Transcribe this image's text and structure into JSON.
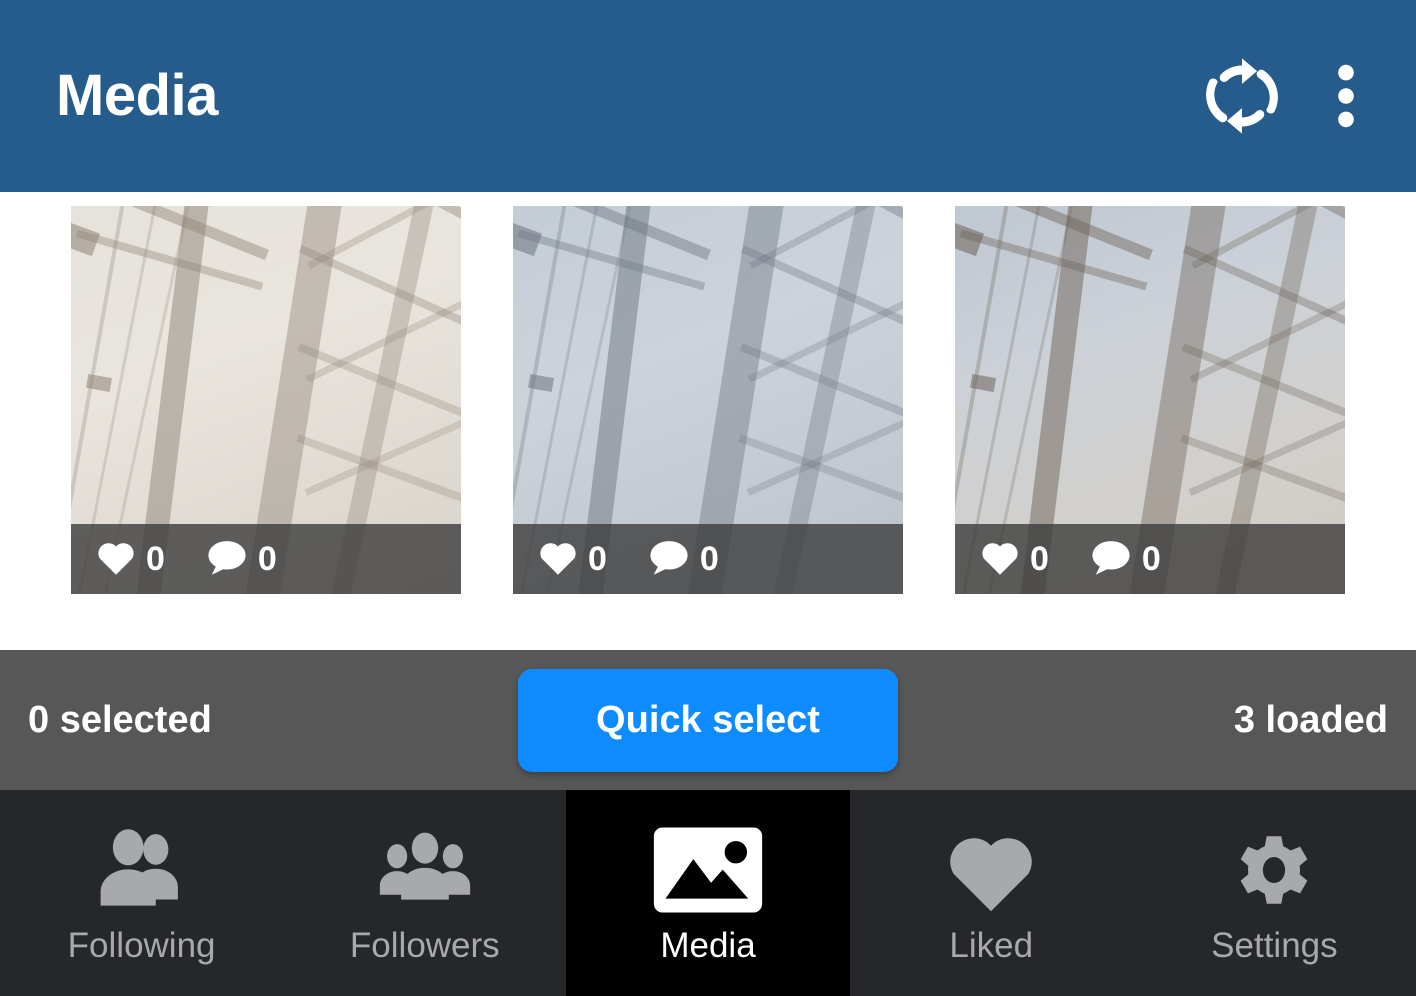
{
  "header": {
    "title": "Media",
    "refresh_icon": "refresh-sync-icon",
    "overflow_icon": "more-vertical-icon"
  },
  "media_grid": {
    "tiles": [
      {
        "like_icon": "heart-icon",
        "likes": "0",
        "comment_icon": "comment-bubble-icon",
        "comments": "0",
        "alt": "electricity pylon lattice tower"
      },
      {
        "like_icon": "heart-icon",
        "likes": "0",
        "comment_icon": "comment-bubble-icon",
        "comments": "0",
        "alt": "electricity pylon lattice tower"
      },
      {
        "like_icon": "heart-icon",
        "likes": "0",
        "comment_icon": "comment-bubble-icon",
        "comments": "0",
        "alt": "electricity pylon lattice tower"
      }
    ]
  },
  "action_bar": {
    "selected_label": "0 selected",
    "quick_select_label": "Quick select",
    "loaded_label": "3 loaded",
    "button_color": "#0d8bff",
    "background_color": "#575757"
  },
  "bottom_nav": {
    "active": "Media",
    "items": [
      {
        "label": "Following",
        "icon": "two-people-icon",
        "active": false
      },
      {
        "label": "Followers",
        "icon": "group-people-icon",
        "active": false
      },
      {
        "label": "Media",
        "icon": "image-picture-icon",
        "active": true
      },
      {
        "label": "Liked",
        "icon": "heart-icon",
        "active": false
      },
      {
        "label": "Settings",
        "icon": "gear-icon",
        "active": false
      }
    ]
  },
  "colors": {
    "appbar": "#255c8b",
    "accent": "#0d8bff",
    "nav_background": "#26272b",
    "nav_active_background": "#000000"
  }
}
